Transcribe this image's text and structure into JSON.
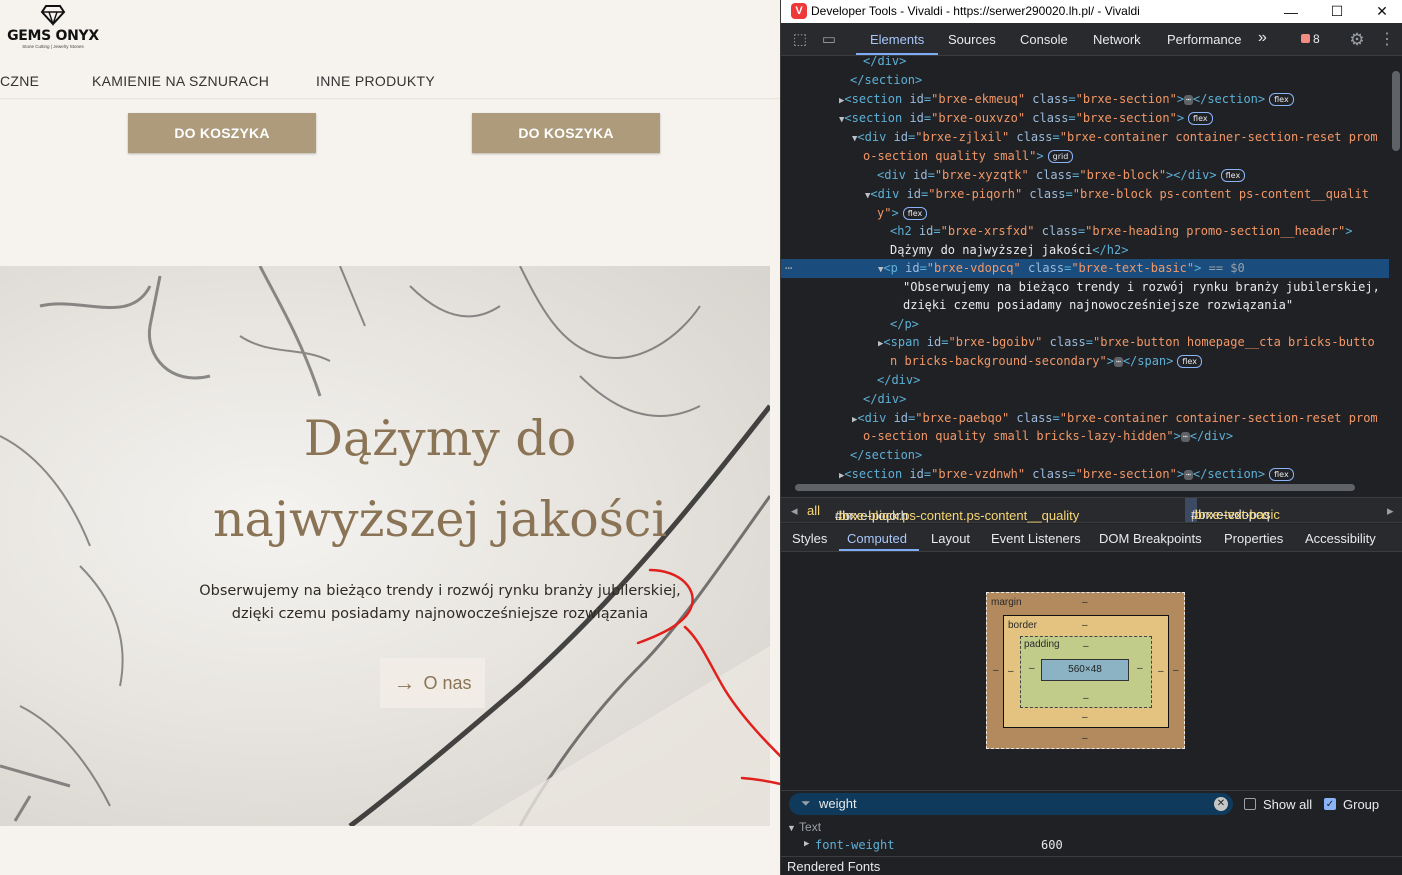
{
  "site": {
    "logo": {
      "name": "GEMS ONYX",
      "tagline": "Stone Cutting | Jewelry Stones"
    },
    "nav": [
      "CZNE",
      "KAMIENIE NA SZNURACH",
      "INNE PRODUKTY"
    ],
    "cart_buttons": [
      "DO KOSZYKA",
      "DO KOSZYKA"
    ],
    "promo": {
      "title_line1": "Dążymy do",
      "title_line2": "najwyższej jakości",
      "text_line1": "Obserwujemy na bieżąco trendy i rozwój rynku branży jubilerskiej,",
      "text_line2": "dzięki czemu posiadamy najnowocześniejsze rozwiązania",
      "button_label": "O nas",
      "button_icon": "arrow-right-icon"
    }
  },
  "devtools": {
    "window_title": "Developer Tools - Vivaldi - https://serwer290020.lh.pl/ - Vivaldi",
    "tabs": [
      "Elements",
      "Sources",
      "Console",
      "Network",
      "Performance"
    ],
    "active_tab": "Elements",
    "more_tabs": "»",
    "error_count": "8",
    "dom": {
      "l0": "</div>",
      "l1": "</section>",
      "l2_id": "\"brxe-ekmeuq\"",
      "l2_cls": "\"brxe-section\"",
      "l3_id": "\"brxe-ouxvzo\"",
      "l3_cls": "\"brxe-section\"",
      "l4_id": "\"brxe-zjlxil\"",
      "l4_cls": "\"brxe-container container-section-reset prom",
      "l5": "o-section quality small\"",
      "l6_id": "\"brxe-xyzqtk\"",
      "l6_cls": "\"brxe-block\"",
      "l7_id": "\"brxe-piqorh\"",
      "l7_cls": "\"brxe-block ps-content ps-content__qualit",
      "l8": "y\"",
      "l9_id": "\"brxe-xrsfxd\"",
      "l9_cls": "\"brxe-heading promo-section__header\"",
      "l10": "Dążymy do najwyższej jakości",
      "l11_id": "\"brxe-vdopcq\"",
      "l11_cls": "\"brxe-text-basic\"",
      "l11_sel": "== $0",
      "l12": "\"Obserwujemy na bieżąco trendy i rozwój rynku branży jubilerskiej,",
      "l13": "dzięki czemu posiadamy najnowocześniejsze rozwiązania\"",
      "l14": "</p>",
      "l15_id": "\"brxe-bgoibv\"",
      "l15_cls": "\"brxe-button homepage__cta bricks-butto",
      "l16": "n bricks-background-secondary\"",
      "l17": "</div>",
      "l18": "</div>",
      "l19_id": "\"brxe-paebqo\"",
      "l19_cls": "\"brxe-container container-section-reset prom",
      "l20": "o-section quality small bricks-lazy-hidden\"",
      "l21": "</section>",
      "l22_id": "\"brxe-vzdnwh\"",
      "l22_cls": "\"brxe-section\"",
      "badge_flex": "flex",
      "badge_grid": "grid"
    },
    "breadcrumbs": {
      "c0": "all",
      "c1_tag": "div",
      "c1_id": "#brxe-piqorh",
      "c1_cls": ".brxe-block.ps-content.ps-content__quality",
      "c2_tag": "p",
      "c2_id": "#brxe-vdopcq",
      "c2_cls": ".brxe-text-basic"
    },
    "subtabs": [
      "Styles",
      "Computed",
      "Layout",
      "Event Listeners",
      "DOM Breakpoints",
      "Properties",
      "Accessibility"
    ],
    "active_subtab": "Computed",
    "box_model": {
      "margin_label": "margin",
      "border_label": "border",
      "padding_label": "padding",
      "content": "560×48",
      "dash": "–"
    },
    "filter": {
      "value": "weight",
      "show_all": "Show all",
      "show_all_checked": false,
      "group": "Group",
      "group_checked": true
    },
    "computed": {
      "section": "Text",
      "prop_name": "font-weight",
      "prop_value": "600"
    },
    "rendered_fonts": "Rendered Fonts"
  }
}
